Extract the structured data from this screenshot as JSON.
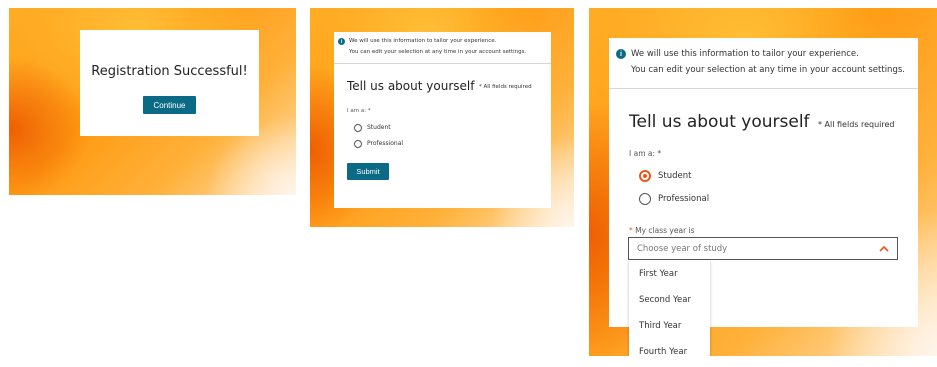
{
  "panel1": {
    "title": "Registration Successful!",
    "continue_label": "Continue"
  },
  "panel2": {
    "info_line1": "We will use this information to tailor your experience.",
    "info_line2": "You can edit your selection at any time in your account settings.",
    "heading": "Tell us about yourself",
    "required_note": "* All fields required",
    "iam_label": "I am a: *",
    "option_student": "Student",
    "option_professional": "Professional",
    "submit_label": "Submit"
  },
  "panel3": {
    "info_line1": "We will use this information to tailor your experience.",
    "info_line2": "You can edit your selection at any time in your account settings.",
    "heading": "Tell us about yourself",
    "required_note": "* All fields required",
    "iam_label": "I am a: *",
    "option_student": "Student",
    "option_professional": "Professional",
    "selected_option": "Student",
    "class_year_label_asterisk": "*",
    "class_year_label": "My class year is",
    "select_placeholder": "Choose year of study",
    "options": [
      "First Year",
      "Second Year",
      "Third Year",
      "Fourth Year"
    ]
  },
  "colors": {
    "accent_teal": "#0b6a86",
    "accent_orange": "#e8581c",
    "background_orange": "#ff9a12"
  },
  "icons": {
    "info": "info-circle-icon",
    "chevron": "chevron-up-icon"
  }
}
